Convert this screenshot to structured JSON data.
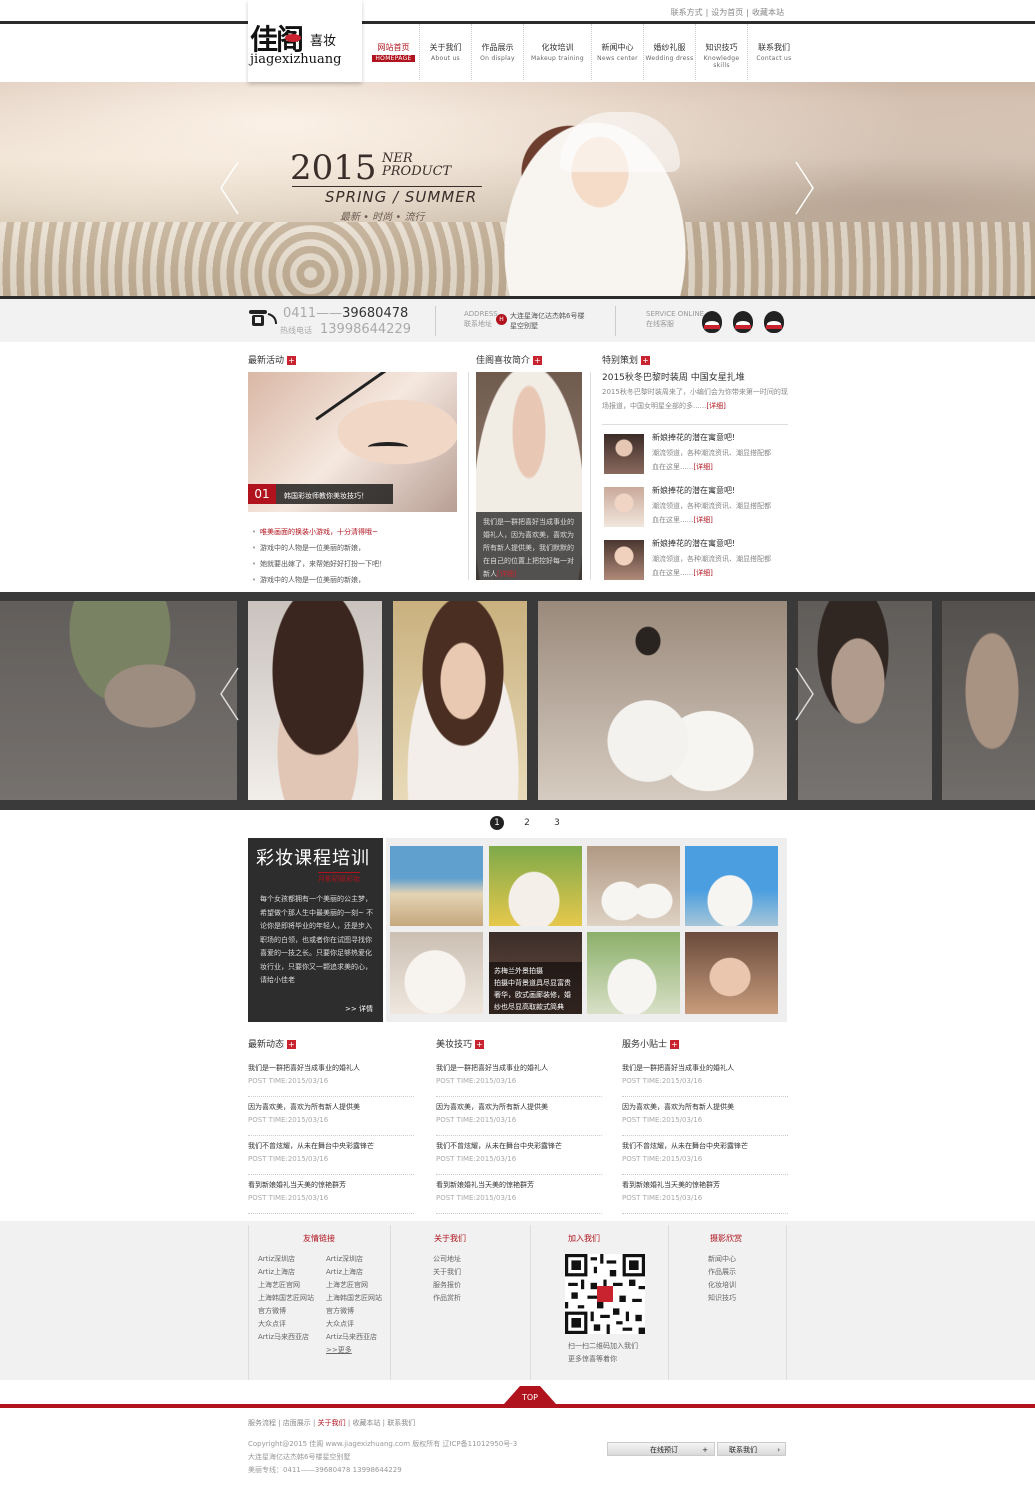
{
  "header": {
    "top_links": [
      "联系方式",
      "设为首页",
      "收藏本站"
    ],
    "logo": {
      "cn_big": "佳阁",
      "cn_small": "喜妆",
      "pinyin": "jiagexizhuang"
    },
    "nav": [
      {
        "cn": "网站首页",
        "en": "HOMEPAGE",
        "active": true
      },
      {
        "cn": "关于我们",
        "en": "About us"
      },
      {
        "cn": "作品展示",
        "en": "On display"
      },
      {
        "cn": "化妆培训",
        "en": "Makeup training"
      },
      {
        "cn": "新闻中心",
        "en": "News center"
      },
      {
        "cn": "婚纱礼服",
        "en": "Wedding dress"
      },
      {
        "cn": "知识技巧",
        "en": "Knowledge skills"
      },
      {
        "cn": "联系我们",
        "en": "Contact us"
      }
    ]
  },
  "hero": {
    "year": "2015",
    "ner": "NER",
    "product": "PRODUCT",
    "season": "SPRING / SUMMER",
    "tags": "最新 • 时尚 • 流行"
  },
  "contact": {
    "phone_area": "0411——",
    "phone_num": "39680478",
    "hotline_label": "热线电话",
    "mobile": "13998644229",
    "address_en": "ADDRESS",
    "address_cn": "联系地址",
    "address_line1": "大连星海亿达杰韩6号楼",
    "address_line2": "星空别墅",
    "service_en": "SERVICE ONLINE",
    "service_cn": "在线客服"
  },
  "latest": {
    "title": "最新活动",
    "caption_num": "01",
    "caption": "韩国彩妆师教你美妆技巧！",
    "items": [
      "唯美画面的换装小游戏，十分清得哦~",
      "游戏中的人物是一位美丽的新娘，",
      "她就要出嫁了，来帮她好好打扮一下吧！",
      "游戏中的人物是一位美丽的新娘，"
    ]
  },
  "intro": {
    "title": "佳阁喜妆简介",
    "text": "我们是一群把喜好当成事业的婚礼人，因为喜欢美，喜欢为所有新人提供美，我们默默的在自己的位置上把控好每一对新人",
    "more": "[详细]"
  },
  "special": {
    "title": "特别策划",
    "headline": "2015秋冬巴黎时装周 中国女星扎堆",
    "desc": "2015秋冬巴黎时装周来了，小编们会为你带来第一时间的现场报道，中国女明星全部的多......",
    "more": "[详细]",
    "items": [
      {
        "t": "新娘捧花的潜在寓意吧!",
        "d1": "潮流领道，各种潮流资讯、潮显搭配都",
        "d2": "血在这里......",
        "more": "[详细]"
      },
      {
        "t": "新娘捧花的潜在寓意吧!",
        "d1": "潮流领道，各种潮流资讯、潮显搭配都",
        "d2": "血在这里......",
        "more": "[详细]"
      },
      {
        "t": "新娘捧花的潜在寓意吧!",
        "d1": "潮流领道，各种潮流资讯、潮显搭配都",
        "d2": "血在这里......",
        "more": "[详细]"
      }
    ]
  },
  "pager": [
    "1",
    "2",
    "3"
  ],
  "course": {
    "title": "彩妆课程培训",
    "subtitle": "月影初级彩妆",
    "text": "每个女孩都拥有一个美丽的公主梦，希望做个那人生中最美丽的一刻~ 不论你是即将毕业的年轻人，还是步入职场的白领，也或者你在试图寻找你喜爱的一技之长。只要你足够热爱化妆行业，只要你又一颗追求美的心，请给小佳老",
    "more": ">> 详情",
    "photo_caption_title": "苏梅兰外景拍摄",
    "photo_caption_text": "拍摄中背景道具尽显富贵奢华，欧式画廊装修，婚纱也尽显高取款式简典"
  },
  "lists": [
    {
      "title": "最新动态",
      "rows": [
        {
          "a": "我们是一群把喜好当成事业的婚礼人",
          "b": "POST TIME:2015/03/16"
        },
        {
          "a": "因为喜欢美，喜欢为所有新人提供美",
          "b": "POST TIME:2015/03/16"
        },
        {
          "a": "我们不曾炫耀，从未在舞台中央彩露锋芒",
          "b": "POST TIME:2015/03/16"
        },
        {
          "a": "看到新娘婚礼当天美的惊艳群芳",
          "b": "POST TIME:2015/03/16"
        }
      ]
    },
    {
      "title": "美妆技巧",
      "rows": [
        {
          "a": "我们是一群把喜好当成事业的婚礼人",
          "b": "POST TIME:2015/03/16"
        },
        {
          "a": "因为喜欢美，喜欢为所有新人提供美",
          "b": "POST TIME:2015/03/16"
        },
        {
          "a": "我们不曾炫耀，从未在舞台中央彩露锋芒",
          "b": "POST TIME:2015/03/16"
        },
        {
          "a": "看到新娘婚礼当天美的惊艳群芳",
          "b": "POST TIME:2015/03/16"
        }
      ]
    },
    {
      "title": "服务小贴士",
      "rows": [
        {
          "a": "我们是一群把喜好当成事业的婚礼人",
          "b": "POST TIME:2015/03/16"
        },
        {
          "a": "因为喜欢美，喜欢为所有新人提供美",
          "b": "POST TIME:2015/03/16"
        },
        {
          "a": "我们不曾炫耀，从未在舞台中央彩露锋芒",
          "b": "POST TIME:2015/03/16"
        },
        {
          "a": "看到新娘婚礼当天美的惊艳群芳",
          "b": "POST TIME:2015/03/16"
        }
      ]
    }
  ],
  "footer": {
    "friends_title": "友情链接",
    "friends_left": [
      "Artiz深圳店",
      "Artiz上海店",
      "上海艺匠官网",
      "上海韩国艺匠网站",
      "官方微博",
      "大众点评",
      "Artiz马来西亚店"
    ],
    "friends_right": [
      "Artiz深圳店",
      "Artiz上海店",
      "上海艺匠官网",
      "上海韩国艺匠网站",
      "官方微博",
      "大众点评",
      "Artiz马来西亚店",
      ">>更多"
    ],
    "about_title": "关于我们",
    "about": [
      "公司地址",
      "关于我们",
      "服务报价",
      "作品赏析"
    ],
    "join_title": "加入我们",
    "join_l1": "扫一扫二维码加入我们",
    "join_l2": "更多惊喜等着你",
    "photo_title": "摄影欣赏",
    "photo": [
      "新闻中心",
      "作品展示",
      "化妆培训",
      "知识技巧"
    ],
    "top": "TOP",
    "bottom_links": [
      "服务流程",
      "店面展示",
      "关于我们",
      "收藏本站",
      "联系我们"
    ],
    "copyright": "Copyright@2015 佳阁 www.jiagexizhuang.com 版权所有 辽ICP备11012950号-3",
    "address": "大连星海亿达杰韩6号楼星空别墅",
    "hotline": "美丽专线：0411——39680478  13998644229",
    "btn_order": "在线预订",
    "btn_contact": "联系我们"
  }
}
